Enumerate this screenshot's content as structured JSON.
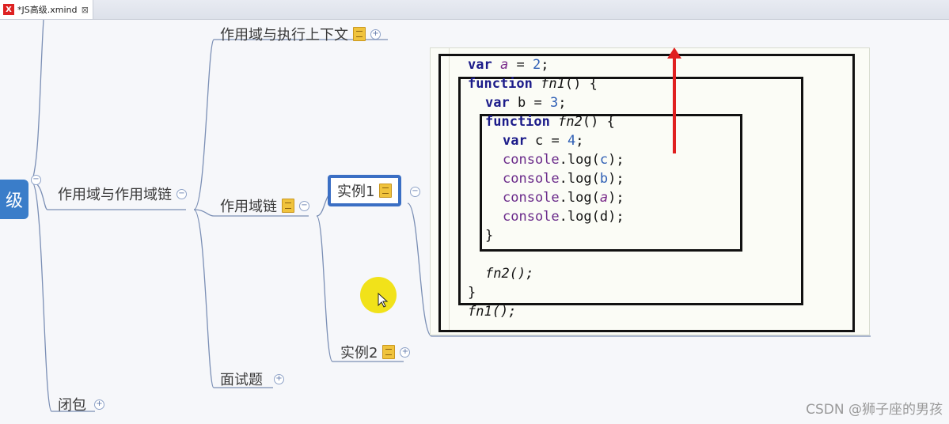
{
  "tab": {
    "title": "*JS高级.xmind",
    "close": "⊠",
    "icon": "X"
  },
  "mindmap": {
    "root_label": "级",
    "branch_scope": "作用域与作用域链",
    "branch_closure": "闭包",
    "sub_exec_context": "作用域与执行上下文",
    "sub_scope_chain": "作用域链",
    "sub_interview": "面试题",
    "example1": "实例1",
    "example2": "实例2",
    "toggle_expand": "+",
    "toggle_collapse": "−"
  },
  "code": {
    "line1": {
      "kw": "var",
      "name": "a",
      "rest": " = ",
      "num": "2",
      "end": ";"
    },
    "line2": {
      "kw": "function",
      "name": "fn1",
      "rest": "() {"
    },
    "line3": {
      "kw": "var",
      "name": "b",
      "rest": " = ",
      "num": "3",
      "end": ";"
    },
    "line4": {
      "kw": "function",
      "name": "fn2",
      "rest": "() {"
    },
    "line5": {
      "kw": "var",
      "name": "c",
      "rest": " = ",
      "num": "4",
      "end": ";"
    },
    "line6": {
      "obj": "console",
      "fn": ".log(",
      "arg": "c",
      "end": ");"
    },
    "line7": {
      "obj": "console",
      "fn": ".log(",
      "arg": "b",
      "end": ");"
    },
    "line8": {
      "obj": "console",
      "fn": ".log(",
      "arg": "a",
      "end": ");"
    },
    "line9": {
      "obj": "console",
      "fn": ".log(",
      "arg": "d",
      "end": ");"
    },
    "line10": "}",
    "line11": "fn2();",
    "line12": "}",
    "line13": "fn1();"
  },
  "colors": {
    "arrow": "#e02020",
    "selection": "#3b6fc4",
    "root": "#3a7dc9",
    "highlight": "#f1e21a"
  },
  "watermark": "CSDN @狮子座的男孩"
}
